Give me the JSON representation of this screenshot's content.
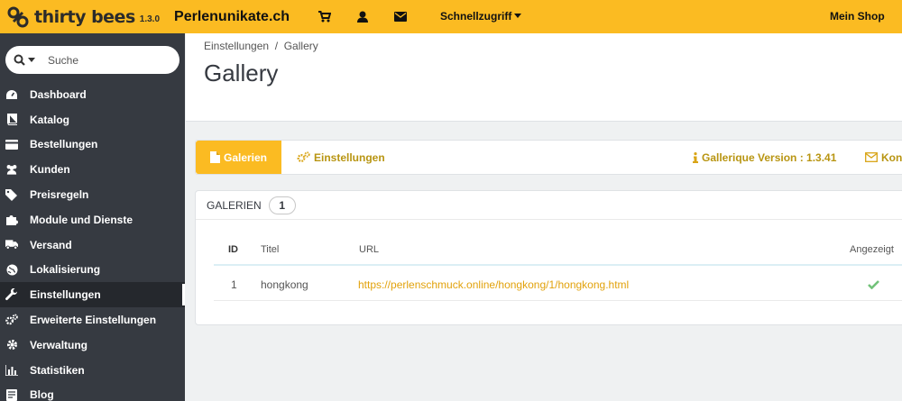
{
  "topbar": {
    "brand": "thirty bees",
    "version": "1.3.0",
    "shop_name": "Perlenunikate.ch",
    "icons": [
      "cart-icon",
      "user-icon",
      "envelope-icon"
    ],
    "quick_access": "Schnellzugriff",
    "my_shop": "Mein Shop"
  },
  "sidebar": {
    "search_placeholder": "Suche",
    "items": [
      {
        "label": "Dashboard",
        "icon": "dashboard-icon"
      },
      {
        "label": "Katalog",
        "icon": "book-icon"
      },
      {
        "label": "Bestellungen",
        "icon": "credit-card-icon"
      },
      {
        "label": "Kunden",
        "icon": "users-icon"
      },
      {
        "label": "Preisregeln",
        "icon": "tags-icon"
      },
      {
        "label": "Module und Dienste",
        "icon": "puzzle-icon"
      },
      {
        "label": "Versand",
        "icon": "truck-icon"
      },
      {
        "label": "Lokalisierung",
        "icon": "globe-icon"
      },
      {
        "label": "Einstellungen",
        "icon": "wrench-icon",
        "active": true
      },
      {
        "label": "Erweiterte Einstellungen",
        "icon": "cogs-icon"
      },
      {
        "label": "Verwaltung",
        "icon": "cog-icon"
      },
      {
        "label": "Statistiken",
        "icon": "bar-chart-icon"
      },
      {
        "label": "Blog",
        "icon": "document-icon"
      }
    ]
  },
  "header": {
    "breadcrumb": "Einstellungen  /  Gallery",
    "title": "Gallery"
  },
  "tabs": {
    "galerien": "Galerien",
    "einstellungen": "Einstellungen",
    "version": "Gallerique Version : 1.3.41",
    "kontakt": "Kon"
  },
  "panel": {
    "title": "GALERIEN",
    "count": "1",
    "columns": [
      "ID",
      "Titel",
      "URL",
      "Angezeigt"
    ],
    "rows": [
      {
        "id": "1",
        "title": "hongkong",
        "url": "https://perlenschmuck.online/hongkong/1/hongkong.html",
        "shown": true
      }
    ]
  },
  "colors": {
    "accent": "#fbbb22",
    "sidebar": "#363a41",
    "link": "#e2a20c",
    "check": "#72c279"
  }
}
